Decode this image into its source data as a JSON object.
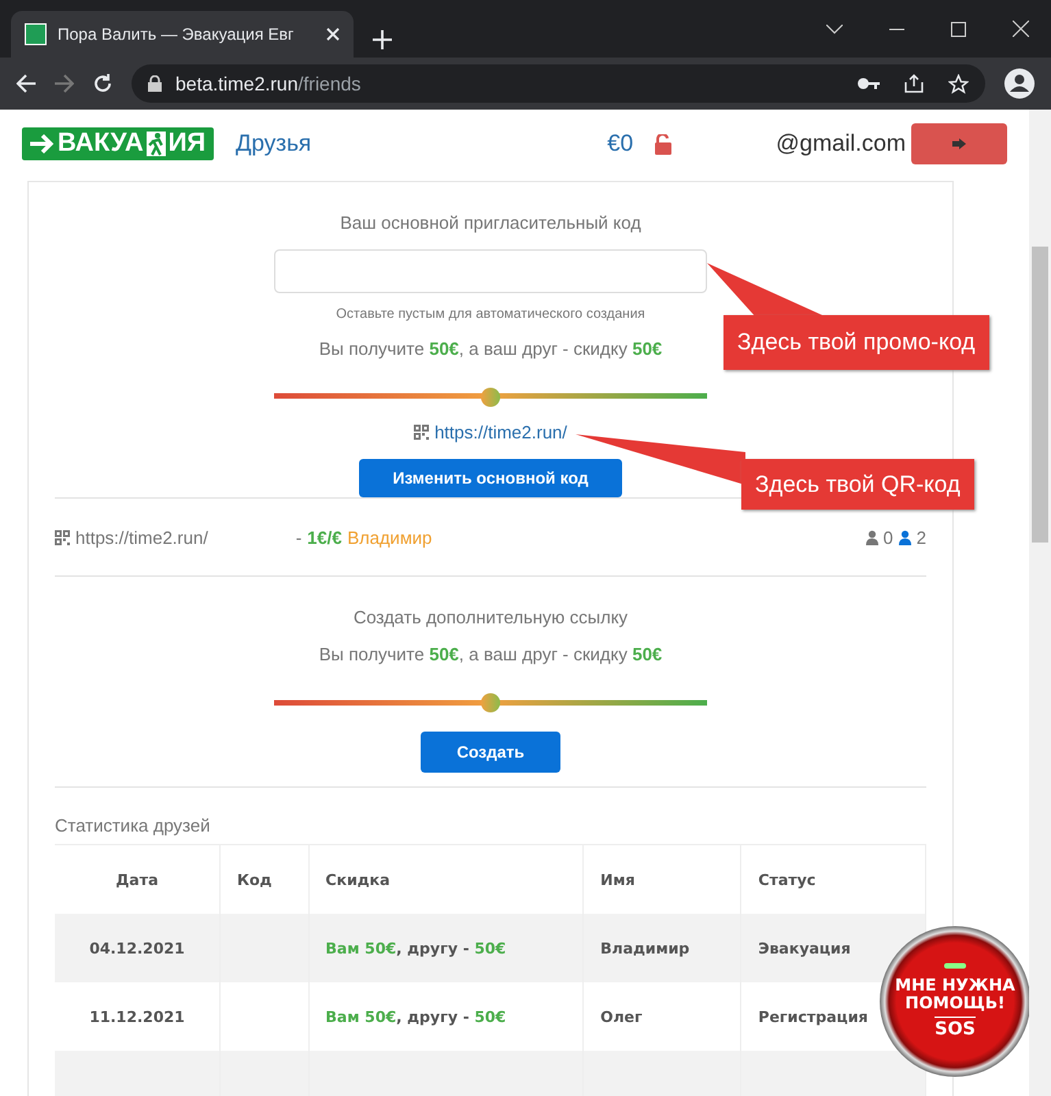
{
  "browser": {
    "tab_title": "Пора Валить — Эвакуация Евг",
    "url_host": "beta.time2.run",
    "url_path": "/friends"
  },
  "header": {
    "logo_left": "ВАКУА",
    "logo_right": "ИЯ",
    "nav_link": "Друзья",
    "balance": "€0",
    "email": "@gmail.com"
  },
  "main_code": {
    "title": "Ваш основной пригласительный код",
    "hint": "Оставьте пустым для автоматического создания",
    "reward": "Вы получите **50€**, а ваш друг - скидку **50€**",
    "level": 0.5,
    "link": "https://time2.run/",
    "button": "Изменить основной код"
  },
  "links": [
    {
      "url": "https://time2.run/",
      "prefix": "-",
      "rate": "1€/€",
      "name": "Владимир",
      "count_1": "0",
      "count_2": "2"
    }
  ],
  "extra_link": {
    "title": "Создать дополнительную ссылку",
    "reward": "Вы получите **50€**, а ваш друг - скидку **50€**",
    "level": 0.5,
    "button": "Создать"
  },
  "stats": {
    "title": "Статистика друзей",
    "columns": [
      "Дата",
      "Код",
      "Скидка",
      "Имя",
      "Статус"
    ],
    "rows": [
      [
        "04.12.2021",
        "",
        "**Вам 50€**, другу - **50€**",
        "Владимир",
        "Эвакуация"
      ],
      [
        "11.12.2021",
        "",
        "**Вам 50€**, другу - **50€**",
        "Олег",
        "Регистрация"
      ]
    ]
  },
  "callouts": [
    "Здесь твой промо-код",
    "Здесь твой QR-код"
  ],
  "sos": {
    "line_1": "МНЕ НУЖНА",
    "line_2": "ПОМОЩЬ!",
    "line_3": "SOS"
  }
}
